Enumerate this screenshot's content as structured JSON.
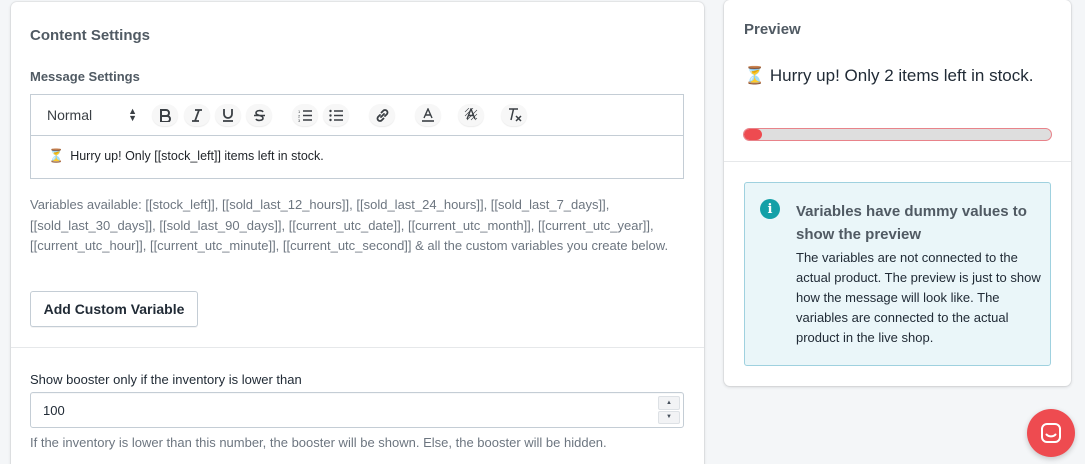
{
  "content_settings": {
    "title": "Content Settings",
    "message_settings_label": "Message Settings",
    "editor": {
      "format_select": "Normal",
      "toolbar_icons": [
        "bold-icon",
        "italic-icon",
        "underline-icon",
        "strikethrough-icon",
        "ordered-list-icon",
        "bullet-list-icon",
        "link-icon",
        "text-color-icon",
        "background-color-icon",
        "clear-format-icon"
      ],
      "content_icon": "⏳",
      "content_text": "Hurry up! Only [[stock_left]] items left in stock."
    },
    "variables_help": "Variables available: [[stock_left]], [[sold_last_12_hours]], [[sold_last_24_hours]], [[sold_last_7_days]], [[sold_last_30_days]], [[sold_last_90_days]], [[current_utc_date]], [[current_utc_month]], [[current_utc_year]], [[current_utc_hour]], [[current_utc_minute]], [[current_utc_second]] & all the custom variables you create below.",
    "add_variable_button": "Add Custom Variable",
    "inventory_field": {
      "label": "Show booster only if the inventory is lower than",
      "value": "100",
      "help": "If the inventory is lower than this number, the booster will be shown. Else, the booster will be hidden."
    }
  },
  "preview": {
    "title": "Preview",
    "message_icon": "⏳",
    "message_text": "Hurry up! Only 2 items left in stock.",
    "progress_fraction": 0.06,
    "progress_color": "#ee4b50",
    "info": {
      "title": "Variables have dummy values to show the preview",
      "body": "The variables are not connected to the actual product. The preview is just to show how the message will look like. The variables are connected to the actual product in the live shop."
    }
  },
  "colors": {
    "accent_red": "#ee4b50",
    "info_teal": "#13a0a7",
    "info_bg": "#eaf6f9"
  }
}
